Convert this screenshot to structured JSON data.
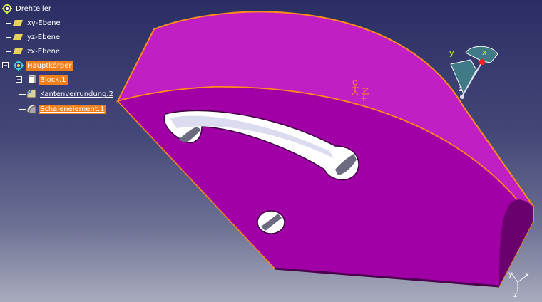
{
  "tree": {
    "root": {
      "label": "Drehteller",
      "icon": "part-gear-icon"
    },
    "planes": [
      {
        "label": "xy-Ebene",
        "icon": "plane-icon"
      },
      {
        "label": "yz-Ebene",
        "icon": "plane-icon"
      },
      {
        "label": "zx-Ebene",
        "icon": "plane-icon"
      }
    ],
    "body": {
      "label": "Hauptkörper",
      "icon": "body-gear-icon"
    },
    "features": [
      {
        "label": "Block.1",
        "icon": "pad-icon",
        "highlighted": true
      },
      {
        "label": "Kantenverrundung.2",
        "icon": "edge-fillet-icon",
        "highlighted": false
      },
      {
        "label": "Schalenelement.1",
        "icon": "shell-icon",
        "highlighted": true
      }
    ]
  },
  "compass": {
    "x_label": "x",
    "y_label": "y",
    "z_label": "z"
  },
  "axis_triad": {
    "x_label": "x",
    "y_label": "y",
    "z_label": "z"
  },
  "colors": {
    "part": "#b000b0",
    "part_top": "#c21ac2",
    "part_side": "#8a008c",
    "edge_highlight": "#ff8c1a",
    "tree_highlight": "#f07f1e",
    "compass": "#3f7a86"
  }
}
